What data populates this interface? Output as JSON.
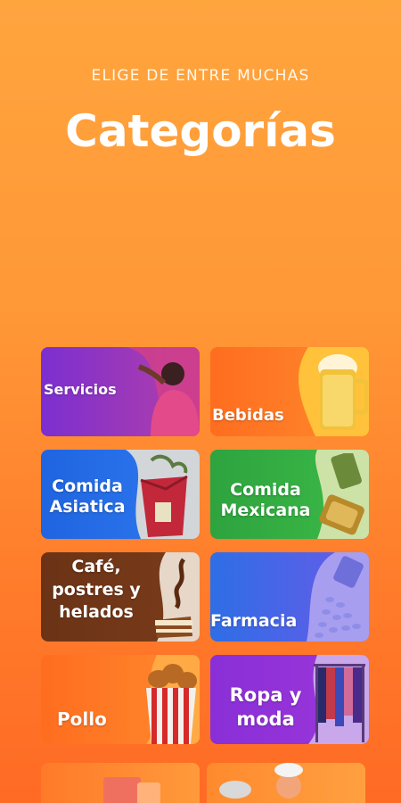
{
  "header": {
    "subtitle": "ELIGE DE ENTRE MUCHAS",
    "title": "Categorías"
  },
  "categories": [
    {
      "label": "Servicios",
      "icon": "person-icon"
    },
    {
      "label": "Bebidas",
      "icon": "beer-mug-icon"
    },
    {
      "label": "Comida Asiatica",
      "icon": "noodle-box-icon"
    },
    {
      "label": "Comida Mexicana",
      "icon": "tamales-icon"
    },
    {
      "label": "Café, postres y helados",
      "icon": "cake-icon"
    },
    {
      "label": "Farmacia",
      "icon": "pills-bottle-icon"
    },
    {
      "label": "Pollo",
      "icon": "fried-chicken-bucket-icon"
    },
    {
      "label": "Ropa y moda",
      "icon": "clothes-rack-icon"
    }
  ],
  "colors": {
    "background_top": "#ffa53e",
    "background_bottom": "#ff6a24"
  }
}
